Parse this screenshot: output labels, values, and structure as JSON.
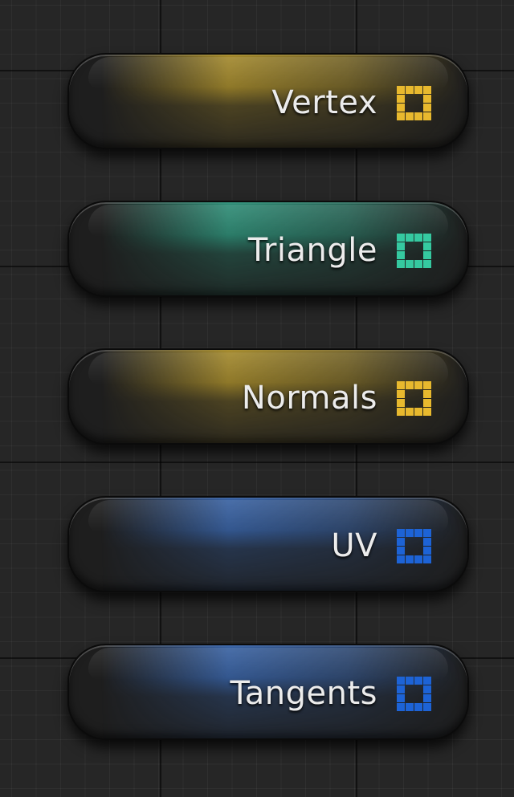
{
  "graph": {
    "nodes": [
      {
        "label": "Vertex",
        "icon": "grid-array-pin-icon",
        "color": "#e8b92e",
        "glow": "#b99a2c"
      },
      {
        "label": "Triangle",
        "icon": "grid-array-pin-icon",
        "color": "#35c9a0",
        "glow": "#2f9f84"
      },
      {
        "label": "Normals",
        "icon": "grid-array-pin-icon",
        "color": "#e8b92e",
        "glow": "#b99a2c"
      },
      {
        "label": "UV",
        "icon": "grid-array-pin-icon",
        "color": "#1d63d6",
        "glow": "#3a6bb8"
      },
      {
        "label": "Tangents",
        "icon": "grid-array-pin-icon",
        "color": "#1d63d6",
        "glow": "#3a6bb8"
      }
    ]
  }
}
